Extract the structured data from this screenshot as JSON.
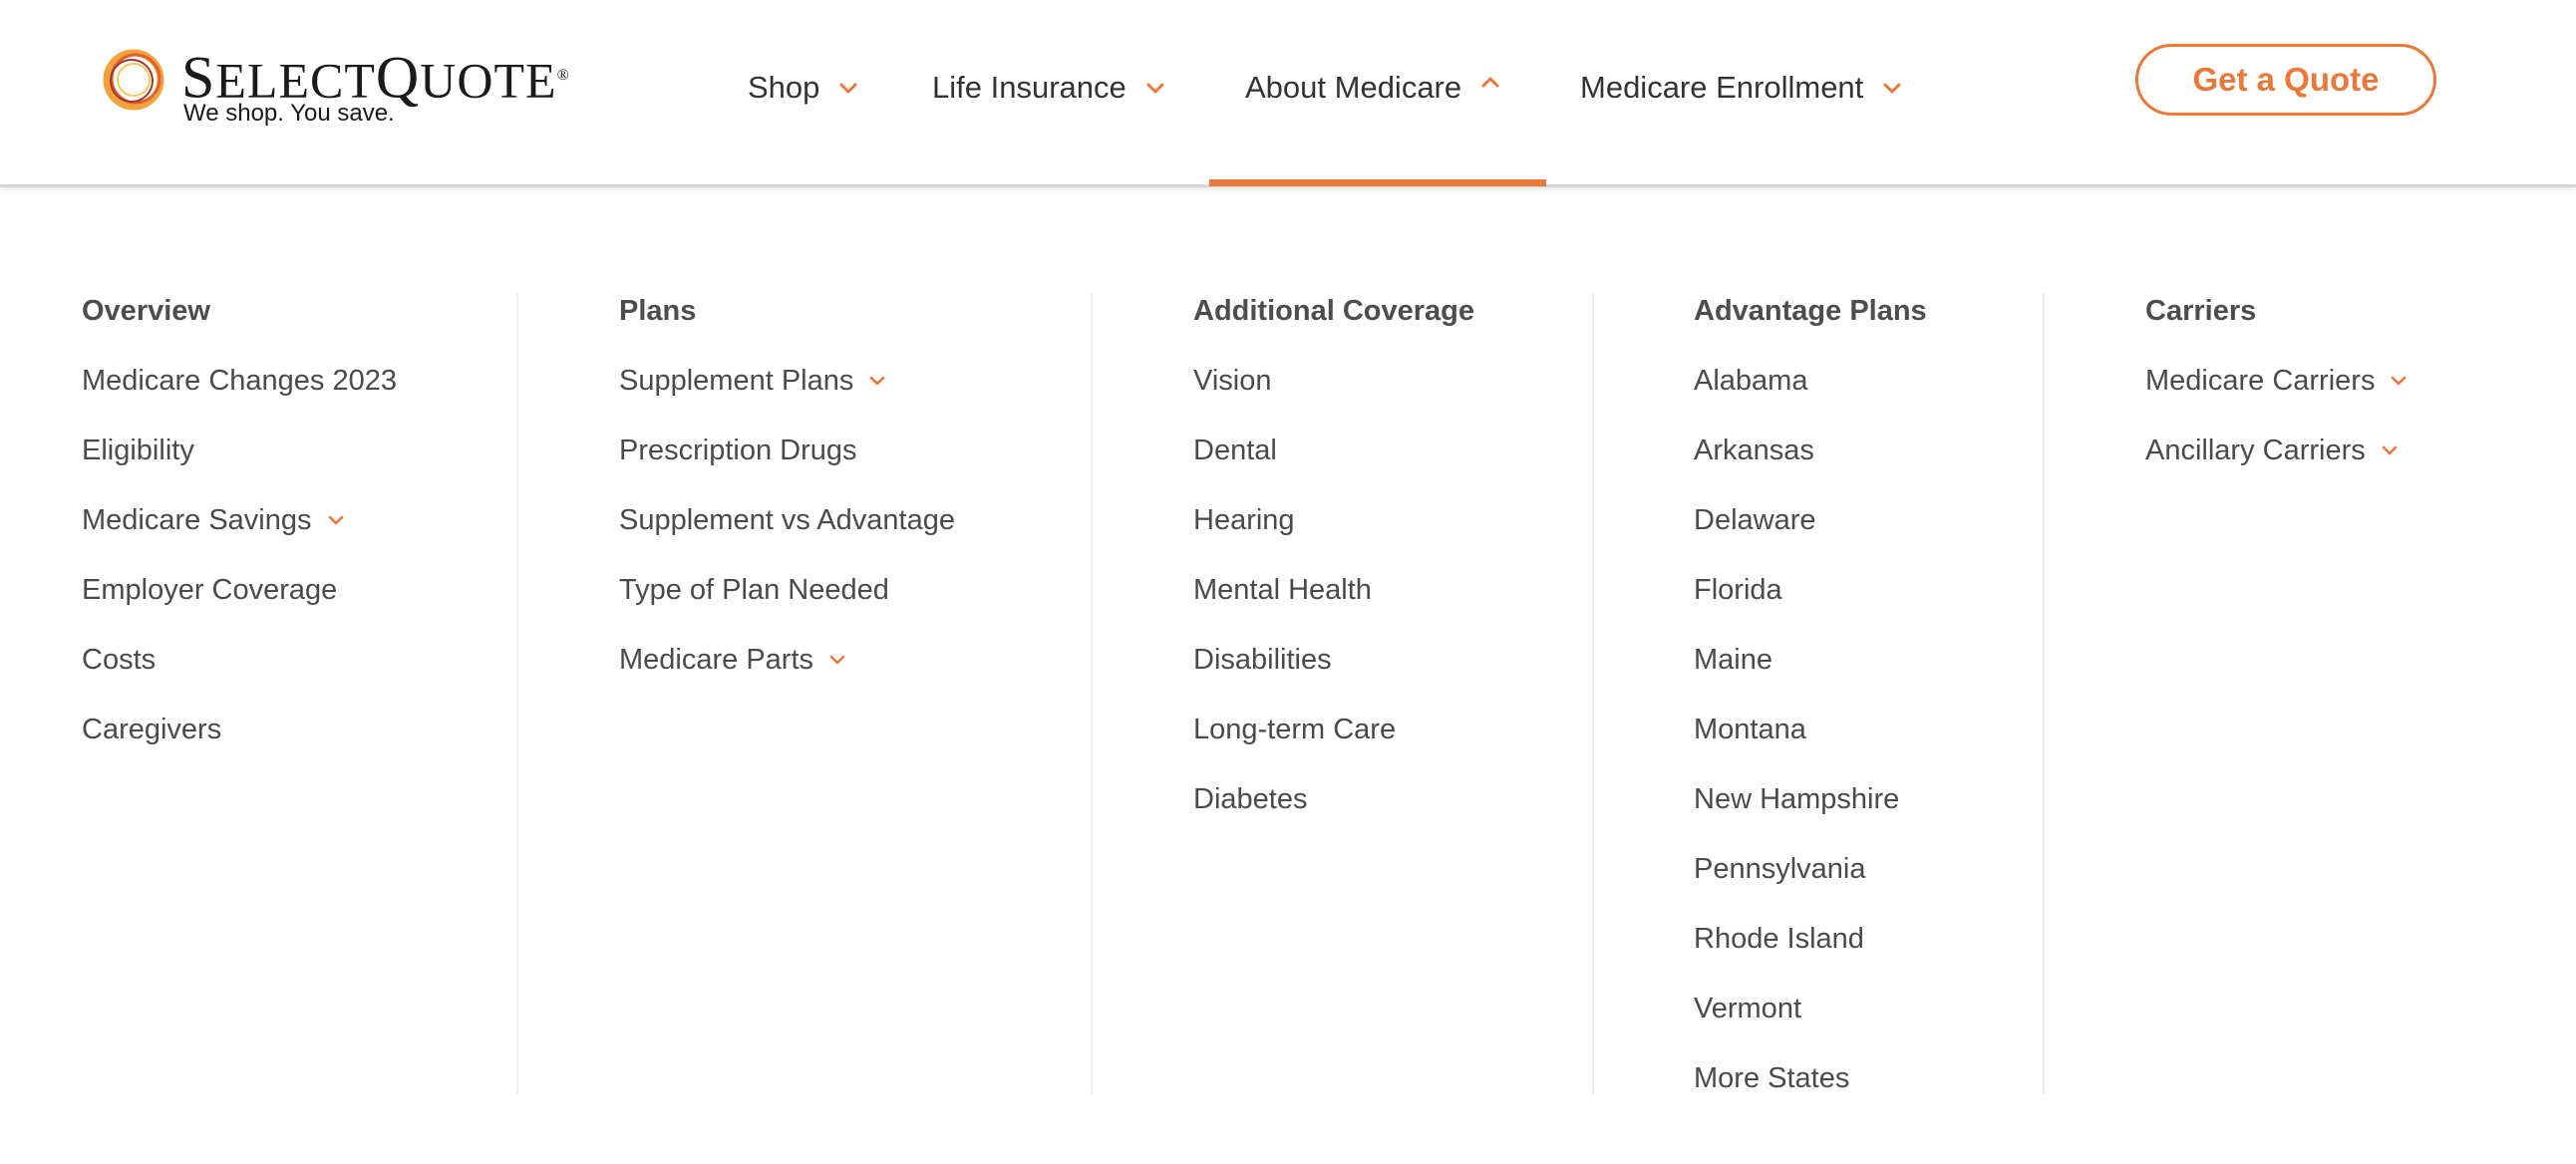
{
  "brand": {
    "name": "SELECTQUOTE",
    "name_parts": [
      "S",
      "ELECT",
      "Q",
      "UOTE"
    ],
    "registered": "®",
    "tagline": "We shop. You save.",
    "accent_color": "#e8793a"
  },
  "nav": [
    {
      "label": "Shop",
      "state": "collapsed",
      "icon": "chevron-down-icon"
    },
    {
      "label": "Life Insurance",
      "state": "collapsed",
      "icon": "chevron-down-icon"
    },
    {
      "label": "About Medicare",
      "state": "expanded",
      "icon": "chevron-up-icon"
    },
    {
      "label": "Medicare Enrollment",
      "state": "collapsed",
      "icon": "chevron-down-icon"
    }
  ],
  "cta": {
    "label": "Get a Quote"
  },
  "menu": {
    "columns": [
      {
        "heading": "Overview",
        "items": [
          {
            "label": "Medicare Changes 2023",
            "expandable": false
          },
          {
            "label": "Eligibility",
            "expandable": false
          },
          {
            "label": "Medicare Savings",
            "expandable": true
          },
          {
            "label": "Employer Coverage",
            "expandable": false
          },
          {
            "label": "Costs",
            "expandable": false
          },
          {
            "label": "Caregivers",
            "expandable": false
          }
        ]
      },
      {
        "heading": "Plans",
        "items": [
          {
            "label": "Supplement Plans",
            "expandable": true
          },
          {
            "label": "Prescription Drugs",
            "expandable": false
          },
          {
            "label": "Supplement vs Advantage",
            "expandable": false
          },
          {
            "label": "Type of Plan Needed",
            "expandable": false
          },
          {
            "label": "Medicare Parts",
            "expandable": true
          }
        ]
      },
      {
        "heading": "Additional Coverage",
        "items": [
          {
            "label": "Vision",
            "expandable": false
          },
          {
            "label": "Dental",
            "expandable": false
          },
          {
            "label": "Hearing",
            "expandable": false
          },
          {
            "label": "Mental Health",
            "expandable": false
          },
          {
            "label": "Disabilities",
            "expandable": false
          },
          {
            "label": "Long-term Care",
            "expandable": false
          },
          {
            "label": "Diabetes",
            "expandable": false
          }
        ]
      },
      {
        "heading": "Advantage Plans",
        "items": [
          {
            "label": "Alabama",
            "expandable": false
          },
          {
            "label": "Arkansas",
            "expandable": false
          },
          {
            "label": "Delaware",
            "expandable": false
          },
          {
            "label": "Florida",
            "expandable": false
          },
          {
            "label": "Maine",
            "expandable": false
          },
          {
            "label": "Montana",
            "expandable": false
          },
          {
            "label": "New Hampshire",
            "expandable": false
          },
          {
            "label": "Pennsylvania",
            "expandable": false
          },
          {
            "label": "Rhode Island",
            "expandable": false
          },
          {
            "label": "Vermont",
            "expandable": false
          },
          {
            "label": "More States",
            "expandable": false
          }
        ]
      },
      {
        "heading": "Carriers",
        "items": [
          {
            "label": "Medicare Carriers",
            "expandable": true
          },
          {
            "label": "Ancillary Carriers",
            "expandable": true
          }
        ]
      }
    ]
  }
}
